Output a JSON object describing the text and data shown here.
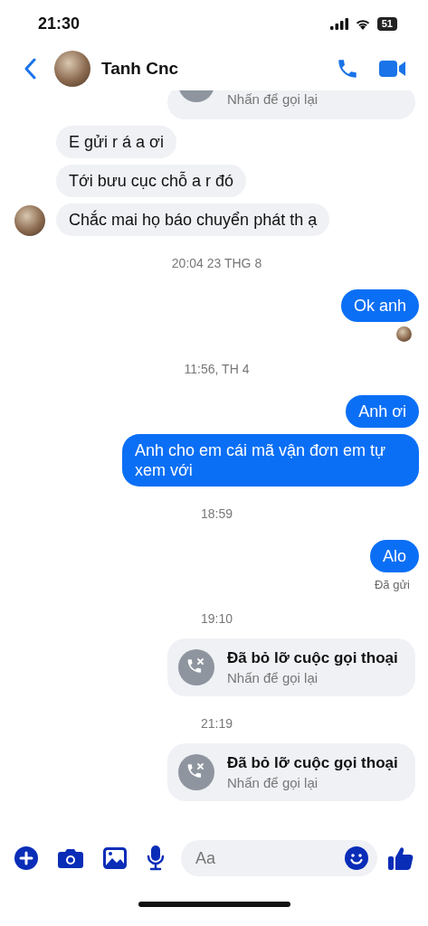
{
  "status_bar": {
    "time": "21:30",
    "battery": "51"
  },
  "header": {
    "contact_name": "Tanh Cnc"
  },
  "messages": [
    {
      "kind": "call_tail",
      "subtitle": "Nhấn để gọi lại"
    },
    {
      "kind": "incoming",
      "text": "E gửi r á a ơi",
      "avatar": false
    },
    {
      "kind": "incoming",
      "text": "Tới bưu cục chỗ a r đó",
      "avatar": false
    },
    {
      "kind": "incoming",
      "text": "Chắc mai họ báo chuyển phát th ạ",
      "avatar": true
    },
    {
      "kind": "time",
      "text": "20:04 23 THG 8"
    },
    {
      "kind": "outgoing",
      "text": "Ok anh"
    },
    {
      "kind": "seen"
    },
    {
      "kind": "time",
      "text": "11:56, TH 4"
    },
    {
      "kind": "outgoing",
      "text": "Anh ơi"
    },
    {
      "kind": "outgoing",
      "text": "Anh cho em cái mã vận đơn em tự xem với"
    },
    {
      "kind": "time",
      "text": "18:59"
    },
    {
      "kind": "outgoing",
      "text": "Alo"
    },
    {
      "kind": "status",
      "text": "Đã gửi"
    },
    {
      "kind": "time",
      "text": "19:10"
    },
    {
      "kind": "call",
      "title": "Đã bỏ lỡ cuộc gọi thoại",
      "subtitle": "Nhấn để gọi lại"
    },
    {
      "kind": "time",
      "text": "21:19"
    },
    {
      "kind": "call",
      "title": "Đã bỏ lỡ cuộc gọi thoại",
      "subtitle": "Nhấn để gọi lại"
    }
  ],
  "composer": {
    "placeholder": "Aa"
  }
}
